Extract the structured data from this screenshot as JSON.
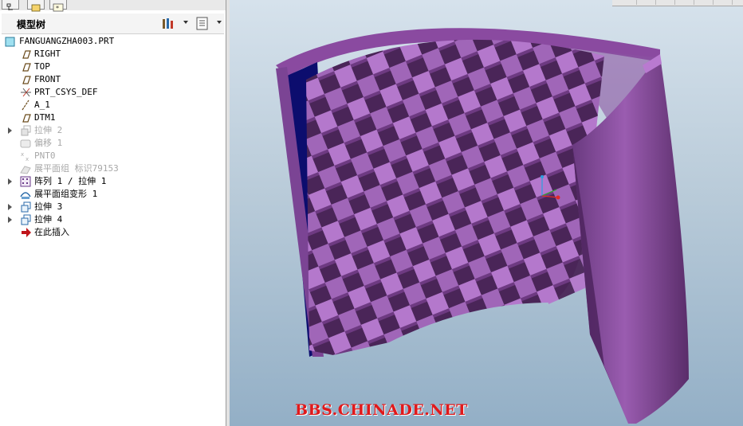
{
  "panel": {
    "title": "模型树"
  },
  "tree": {
    "items": [
      {
        "label": "FANGUANGZHA003.PRT",
        "icon": "part-icon",
        "dim": false,
        "expander": false
      },
      {
        "label": "RIGHT",
        "icon": "datum-plane-icon",
        "dim": false,
        "expander": false
      },
      {
        "label": "TOP",
        "icon": "datum-plane-icon",
        "dim": false,
        "expander": false
      },
      {
        "label": "FRONT",
        "icon": "datum-plane-icon",
        "dim": false,
        "expander": false
      },
      {
        "label": "PRT_CSYS_DEF",
        "icon": "coordinate-system-icon",
        "dim": false,
        "expander": false
      },
      {
        "label": "A_1",
        "icon": "datum-axis-icon",
        "dim": false,
        "expander": false
      },
      {
        "label": "DTM1",
        "icon": "datum-plane-icon",
        "dim": false,
        "expander": false
      },
      {
        "label": "拉伸 2",
        "icon": "extrude-icon",
        "dim": true,
        "expander": true
      },
      {
        "label": "偏移 1",
        "icon": "offset-icon",
        "dim": true,
        "expander": false
      },
      {
        "label": "PNT0",
        "icon": "datum-point-icon",
        "dim": true,
        "expander": false
      },
      {
        "label": "展平面组 标识79153",
        "icon": "flatten-quilt-icon",
        "dim": true,
        "expander": false
      },
      {
        "label": "阵列 1 / 拉伸 1",
        "icon": "pattern-icon",
        "dim": false,
        "expander": true
      },
      {
        "label": "展平面组变形 1",
        "icon": "flatten-deform-icon",
        "dim": false,
        "expander": false
      },
      {
        "label": "拉伸 3",
        "icon": "extrude-icon",
        "dim": false,
        "expander": true
      },
      {
        "label": "拉伸 4",
        "icon": "extrude-icon",
        "dim": false,
        "expander": true
      },
      {
        "label": "在此插入",
        "icon": "insert-here-arrow-icon",
        "dim": false,
        "expander": false
      }
    ]
  },
  "viewport": {
    "watermark": "BBS.CHINADE.NET"
  },
  "colors": {
    "model_face": "#a066b8",
    "model_dark": "#5c2f6e",
    "inner_blue": "#0c0d6e",
    "watermark": "#e0191b"
  }
}
